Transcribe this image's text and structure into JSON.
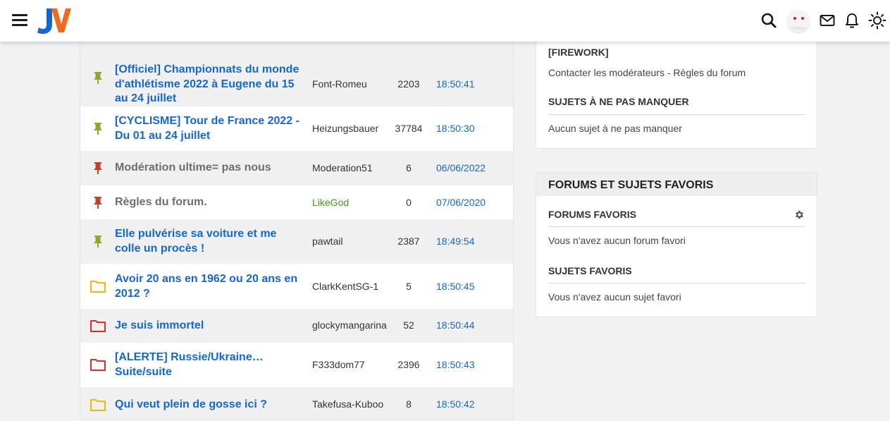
{
  "header": {
    "logo": "JV",
    "icons": [
      "menu-icon",
      "search-icon",
      "avatar",
      "mail-icon",
      "bell-icon",
      "theme-sun-icon"
    ]
  },
  "topics": [
    {
      "icon": "pin-green",
      "title": "[Officiel] Championnats du monde d'athlétisme 2022 à Eugene du 15 au 24 juillet",
      "author": "Font-Romeu",
      "count": "2203",
      "date": "18:50:41"
    },
    {
      "icon": "pin-green",
      "title": "[CYCLISME] Tour de France 2022 - Du 01 au 24 juillet",
      "author": "Heizungsbauer",
      "count": "37784",
      "date": "18:50:30"
    },
    {
      "icon": "pin-red",
      "title": "Modération ultime= pas nous",
      "author": "Moderation51",
      "count": "6",
      "date": "06/06/2022"
    },
    {
      "icon": "pin-red",
      "title": "Règles du forum.",
      "author": "LikeGod",
      "count": "0",
      "date": "07/06/2020"
    },
    {
      "icon": "pin-green",
      "title": "Elle pulvérise sa voiture et me colle un procès !",
      "author": "pawtail",
      "count": "2387",
      "date": "18:49:54"
    },
    {
      "icon": "folder-yellow",
      "title": "Avoir 20 ans en 1962 ou 20 ans en 2012 ?",
      "author": "ClarkKentSG-1",
      "count": "5",
      "date": "18:50:45"
    },
    {
      "icon": "folder-red",
      "title": "Je suis immortel",
      "author": "glockymangarina",
      "count": "52",
      "date": "18:50:44"
    },
    {
      "icon": "folder-red",
      "title": "[ALERTE] Russie/Ukraine… Suite/suite",
      "author": "F333dom77",
      "count": "2396",
      "date": "18:50:43"
    },
    {
      "icon": "folder-yellow",
      "title": "Qui veut plein de gosse ici ?",
      "author": "Takefusa-Kuboo",
      "count": "8",
      "date": "18:50:42"
    }
  ],
  "panel1": {
    "moderators_tail": "[FIREWORK]",
    "contact_moderators": "Contacter les modérateurs",
    "separator": " - ",
    "forum_rules": "Règles du forum",
    "must_see_title": "SUJETS À NE PAS MANQUER",
    "must_see_empty": "Aucun sujet à ne pas manquer"
  },
  "panel2": {
    "title": "FORUMS ET SUJETS FAVORIS",
    "fav_forums_title": "FORUMS FAVORIS",
    "fav_forums_empty": "Vous n'avez aucun forum favori",
    "fav_topics_title": "SUJETS FAVORIS",
    "fav_topics_empty": "Vous n'avez aucun sujet favori"
  },
  "colors": {
    "link_blue": "#1467d3",
    "pin_green": "#8aa92a",
    "pin_red": "#c83c2c",
    "folder_yellow": "#f2b705",
    "folder_red": "#d0312d",
    "author_green": "#3f9a18"
  }
}
